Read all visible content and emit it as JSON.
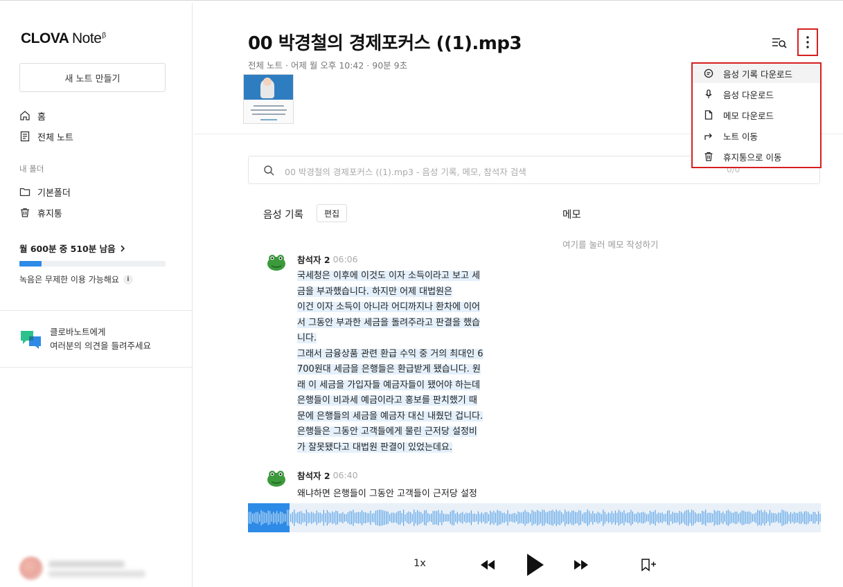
{
  "app": {
    "logo_brand": "CLOVA",
    "logo_product": "Note",
    "logo_sup": "β"
  },
  "sidebar": {
    "new_note_label": "새 노트 만들기",
    "nav": [
      {
        "label": "홈",
        "icon": "home-icon"
      },
      {
        "label": "전체 노트",
        "icon": "document-icon"
      }
    ],
    "folder_title": "내 폴더",
    "folders": [
      {
        "label": "기본폴더",
        "icon": "folder-icon"
      },
      {
        "label": "휴지통",
        "icon": "trash-icon"
      }
    ],
    "quota_text": "월 600분 중 510분 남음",
    "quota_used_fraction": 0.15,
    "quota_note": "녹음은 무제한 이용 가능해요",
    "feedback_line1": "클로바노트에게",
    "feedback_line2": "여러분의 의견을 들려주세요"
  },
  "note": {
    "title": "00 박경철의 경제포커스 ((1).mp3",
    "meta": "전체 노트 · 어제 월 오후 10:42 · 90분 9초"
  },
  "search": {
    "placeholder": "00 박경철의 경제포커스 ((1).mp3 - 음성 기록, 메모, 참석자 검색",
    "count": "0/0"
  },
  "transcript": {
    "section_label": "음성 기록",
    "edit_label": "편집",
    "entries": [
      {
        "speaker": "참석자 2",
        "time": "06:06",
        "lines": [
          "국세청은 이후에 이것도 이자 소득이라고 보고 세",
          "금을 부과했습니다. 하지만 어제 대법원은",
          "이건 이자 소득이 아니라 어디까지나 환차에 이어",
          "서 그동안 부과한 세금을 돌려주라고 판결을 했습",
          "니다.",
          "그래서 금융상품 관련 환급 수익 중 거의 최대인 6",
          "700원대 세금을 은행들은 환급받게 됐습니다. 원",
          "래 이 세금을 가입자들 예금자들이 됐어야 하는데",
          "은행들이 비과세 예금이라고 홍보를 판치했기 때",
          "문에 은행들의 세금을 예금자 대신 내줬던 겁니다.",
          "은행들은 그동안 고객들에게 물린 근저당 설정비",
          "가 잘못됐다고 대법원 판결이 있었는데요."
        ]
      },
      {
        "speaker": "참석자 2",
        "time": "06:40",
        "lines": [
          "왜냐하면 은행들이 그동안 고객들이 근저당 설정"
        ]
      }
    ]
  },
  "memo": {
    "label": "메모",
    "placeholder": "여기를 눌러 메모 작성하기"
  },
  "player": {
    "speed": "1x",
    "progress_fraction": 0.073
  },
  "menu": {
    "items": [
      {
        "label": "음성 기록 다운로드",
        "icon": "transcript-download-icon"
      },
      {
        "label": "음성 다운로드",
        "icon": "microphone-icon"
      },
      {
        "label": "메모 다운로드",
        "icon": "file-icon"
      },
      {
        "label": "노트 이동",
        "icon": "move-arrow-icon"
      },
      {
        "label": "휴지통으로 이동",
        "icon": "trash-icon"
      }
    ]
  },
  "colors": {
    "accent": "#2d8ae6",
    "highlight": "#e4f0fb",
    "annotation_red": "#d61f1f"
  }
}
